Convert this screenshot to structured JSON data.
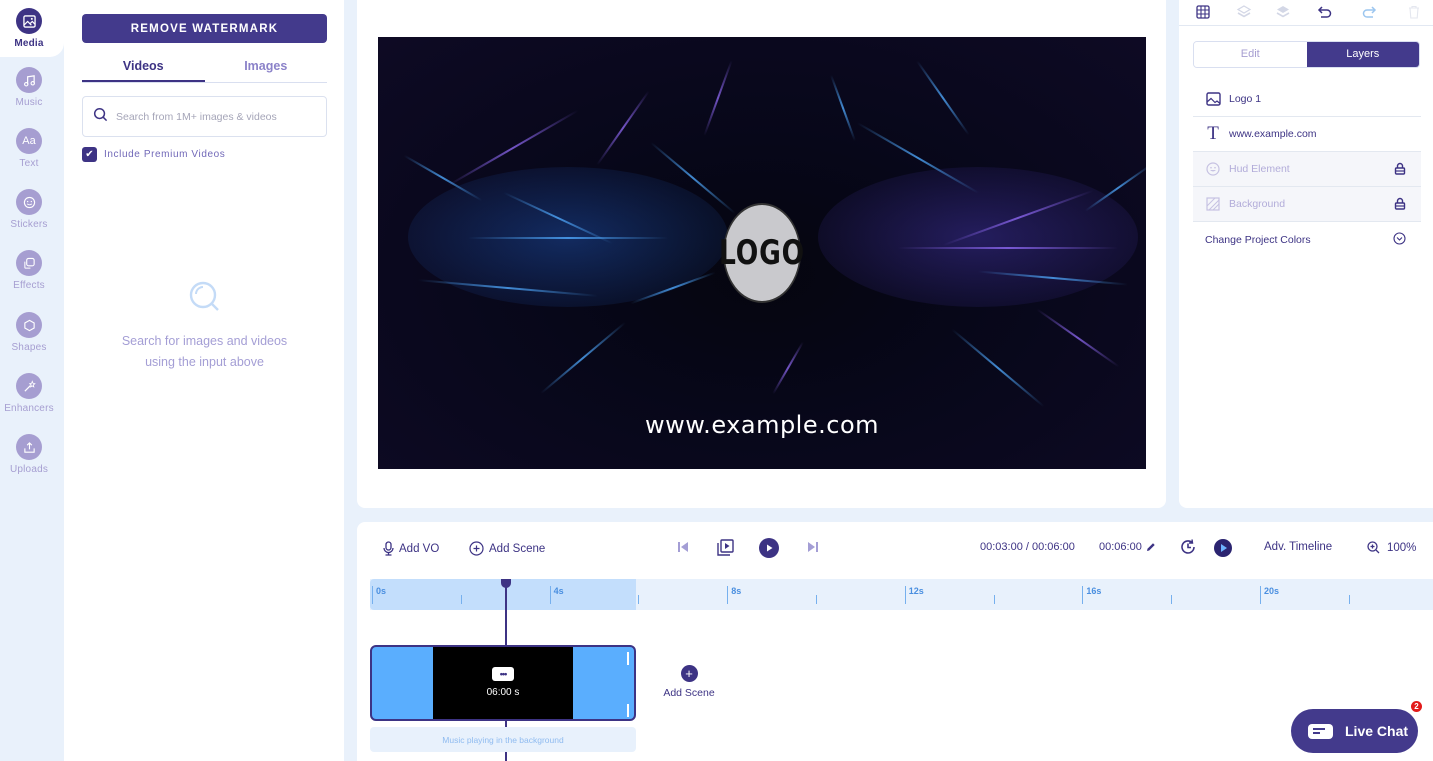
{
  "rail": {
    "items": [
      {
        "label": "Media",
        "icon": "image-icon",
        "active": true
      },
      {
        "label": "Music",
        "icon": "music-icon"
      },
      {
        "label": "Text",
        "icon": "text-icon",
        "glyph": "Aa"
      },
      {
        "label": "Stickers",
        "icon": "smiley-icon"
      },
      {
        "label": "Effects",
        "icon": "effects-icon"
      },
      {
        "label": "Shapes",
        "icon": "hexagon-icon"
      },
      {
        "label": "Enhancers",
        "icon": "magic-wand-icon"
      },
      {
        "label": "Uploads",
        "icon": "upload-icon"
      }
    ]
  },
  "media_panel": {
    "remove_watermark": "REMOVE WATERMARK",
    "tabs": [
      {
        "label": "Videos",
        "active": true
      },
      {
        "label": "Images"
      }
    ],
    "search_placeholder": "Search from 1M+ images & videos",
    "search_value": "",
    "include_premium_label": "Include Premium Videos",
    "include_premium_checked": true,
    "empty_line1": "Search for images and videos",
    "empty_line2": "using the input above"
  },
  "canvas": {
    "logo_text": "LOGO",
    "url_text": "www.example.com"
  },
  "right_panel": {
    "toolbar": [
      "grid-icon",
      "send-backward-icon",
      "bring-forward-icon",
      "undo-icon",
      "redo-icon",
      "delete-icon"
    ],
    "segment": [
      {
        "label": "Edit"
      },
      {
        "label": "Layers",
        "active": true
      }
    ],
    "layers": [
      {
        "label": "Logo 1",
        "icon": "image-icon",
        "locked": false
      },
      {
        "label": "www.example.com",
        "icon": "text-icon",
        "locked": false
      },
      {
        "label": "Hud Element",
        "icon": "smiley-icon",
        "locked": true
      },
      {
        "label": "Background",
        "icon": "background-icon",
        "locked": true
      }
    ],
    "change_colors": "Change Project Colors"
  },
  "timeline": {
    "add_vo": "Add VO",
    "add_scene": "Add Scene",
    "time_display": "00:03:00 / 00:06:00",
    "duration": "00:06:00",
    "adv_timeline": "Adv. Timeline",
    "zoom_level": "100%",
    "ruler_labels": [
      "0s",
      "4s",
      "8s",
      "12s",
      "16s",
      "20s"
    ],
    "playhead_seconds": 3,
    "selected_range_seconds": [
      0,
      6
    ],
    "scene": {
      "duration_label": "06:00 s"
    },
    "music_label": "Music playing in the background",
    "add_scene_tile": "Add Scene"
  },
  "live_chat": {
    "label": "Live Chat",
    "badge": "2"
  }
}
